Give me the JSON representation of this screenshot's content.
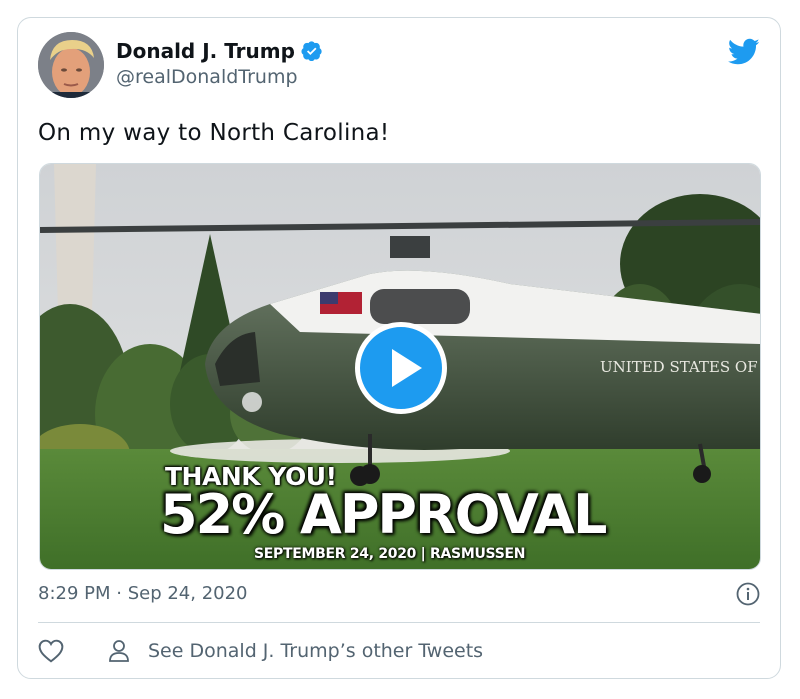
{
  "tweet": {
    "author_name": "Donald J. Trump",
    "handle": "@realDonaldTrump",
    "text": "On my way to North Carolina!",
    "timestamp": "8:29 PM · Sep 24, 2020"
  },
  "media": {
    "overlay_line1": "THANK YOU!",
    "overlay_line2": "52% APPROVAL",
    "overlay_line3": "SEPTEMBER 24, 2020 | RASMUSSEN",
    "helicopter_text": "UNITED STATES OF"
  },
  "actions": {
    "other_tweets_label": "See Donald J. Trump’s other Tweets"
  },
  "colors": {
    "brand_blue": "#1d9bf0",
    "secondary_text": "#536471",
    "border": "#cfd9de"
  },
  "icons": [
    "verified-badge-icon",
    "twitter-bird-icon",
    "play-icon",
    "info-icon",
    "heart-icon",
    "person-icon"
  ]
}
